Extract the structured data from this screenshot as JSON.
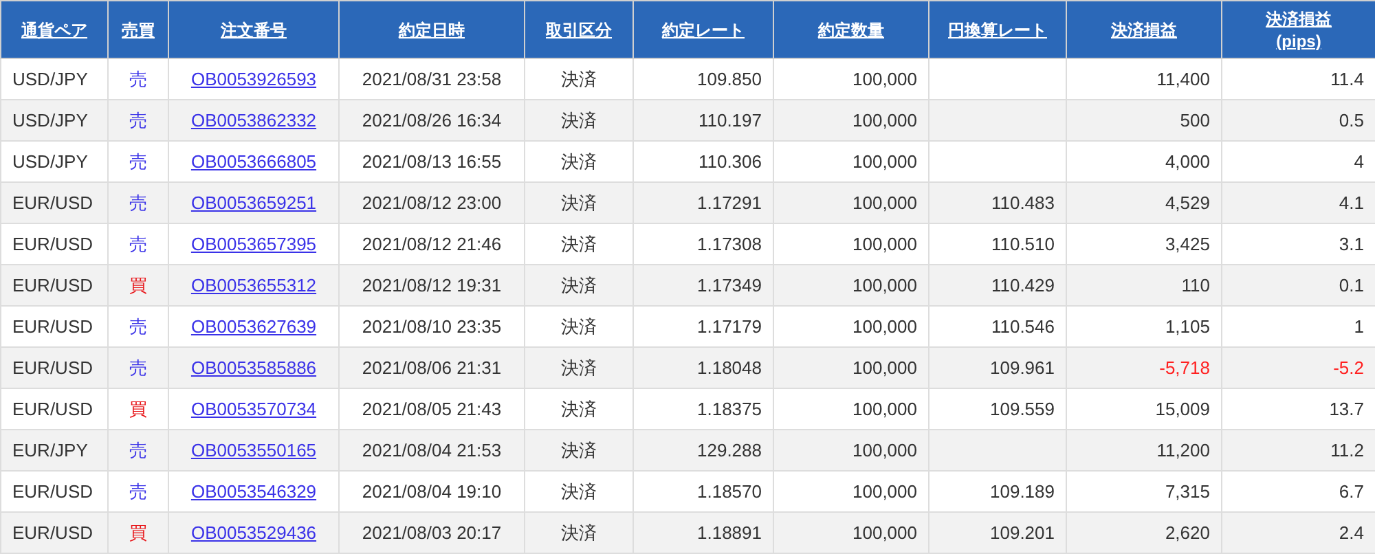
{
  "table": {
    "columns": [
      {
        "label": "通貨ペア"
      },
      {
        "label": "売買"
      },
      {
        "label": "注文番号"
      },
      {
        "label": "約定日時"
      },
      {
        "label": "取引区分"
      },
      {
        "label": "約定レート"
      },
      {
        "label": "約定数量"
      },
      {
        "label": "円換算レート"
      },
      {
        "label": "決済損益"
      },
      {
        "label": "決済損益",
        "sub": "(pips)"
      }
    ],
    "rows": [
      {
        "pair": "USD/JPY",
        "side": "売",
        "kind": "sell",
        "order": "OB0053926593",
        "datetime": "2021/08/31 23:58",
        "type": "決済",
        "rate": "109.850",
        "qty": "100,000",
        "pl": "11,400",
        "pips": "11.4",
        "negative": false
      },
      {
        "pair": "USD/JPY",
        "side": "売",
        "kind": "sell",
        "order": "OB0053862332",
        "datetime": "2021/08/26 16:34",
        "type": "決済",
        "rate": "110.197",
        "qty": "100,000",
        "pl": "500",
        "pips": "0.5",
        "negative": false
      },
      {
        "pair": "USD/JPY",
        "side": "売",
        "kind": "sell",
        "order": "OB0053666805",
        "datetime": "2021/08/13 16:55",
        "type": "決済",
        "rate": "110.306",
        "qty": "100,000",
        "pl": "4,000",
        "pips": "4",
        "negative": false
      },
      {
        "pair": "EUR/USD",
        "side": "売",
        "kind": "sell",
        "order": "OB0053659251",
        "datetime": "2021/08/12 23:00",
        "type": "決済",
        "rate": "1.17291",
        "qty": "100,000",
        "jpy_rate": "110.483",
        "pl": "4,529",
        "pips": "4.1",
        "negative": false
      },
      {
        "pair": "EUR/USD",
        "side": "売",
        "kind": "sell",
        "order": "OB0053657395",
        "datetime": "2021/08/12 21:46",
        "type": "決済",
        "rate": "1.17308",
        "qty": "100,000",
        "jpy_rate": "110.510",
        "pl": "3,425",
        "pips": "3.1",
        "negative": false
      },
      {
        "pair": "EUR/USD",
        "side": "買",
        "kind": "buy",
        "order": "OB0053655312",
        "datetime": "2021/08/12 19:31",
        "type": "決済",
        "rate": "1.17349",
        "qty": "100,000",
        "jpy_rate": "110.429",
        "pl": "110",
        "pips": "0.1",
        "negative": false
      },
      {
        "pair": "EUR/USD",
        "side": "売",
        "kind": "sell",
        "order": "OB0053627639",
        "datetime": "2021/08/10 23:35",
        "type": "決済",
        "rate": "1.17179",
        "qty": "100,000",
        "jpy_rate": "110.546",
        "pl": "1,105",
        "pips": "1",
        "negative": false
      },
      {
        "pair": "EUR/USD",
        "side": "売",
        "kind": "sell",
        "order": "OB0053585886",
        "datetime": "2021/08/06 21:31",
        "type": "決済",
        "rate": "1.18048",
        "qty": "100,000",
        "jpy_rate": "109.961",
        "pl": "-5,718",
        "pips": "-5.2",
        "negative": true
      },
      {
        "pair": "EUR/USD",
        "side": "買",
        "kind": "buy",
        "order": "OB0053570734",
        "datetime": "2021/08/05 21:43",
        "type": "決済",
        "rate": "1.18375",
        "qty": "100,000",
        "jpy_rate": "109.559",
        "pl": "15,009",
        "pips": "13.7",
        "negative": false
      },
      {
        "pair": "EUR/JPY",
        "side": "売",
        "kind": "sell",
        "order": "OB0053550165",
        "datetime": "2021/08/04 21:53",
        "type": "決済",
        "rate": "129.288",
        "qty": "100,000",
        "pl": "11,200",
        "pips": "11.2",
        "negative": false
      },
      {
        "pair": "EUR/USD",
        "side": "売",
        "kind": "sell",
        "order": "OB0053546329",
        "datetime": "2021/08/04 19:10",
        "type": "決済",
        "rate": "1.18570",
        "qty": "100,000",
        "jpy_rate": "109.189",
        "pl": "7,315",
        "pips": "6.7",
        "negative": false
      },
      {
        "pair": "EUR/USD",
        "side": "買",
        "kind": "buy",
        "order": "OB0053529436",
        "datetime": "2021/08/03 20:17",
        "type": "決済",
        "rate": "1.18891",
        "qty": "100,000",
        "jpy_rate": "109.201",
        "pl": "2,620",
        "pips": "2.4",
        "negative": false
      }
    ]
  }
}
